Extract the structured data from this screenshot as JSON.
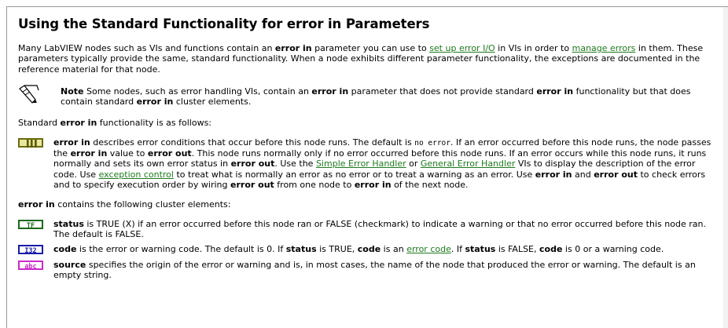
{
  "title": "Using the Standard Functionality for error in Parameters",
  "intro": {
    "t1": "Many LabVIEW nodes such as VIs and functions contain an ",
    "b1": "error in",
    "t2": " parameter you can use to ",
    "link1": "set up error I/O",
    "t3": " in VIs in order to ",
    "link2": "manage errors",
    "t4": " in them. These parameters typically provide the same, standard functionality. When a node exhibits different parameter functionality, the exceptions are documented in the reference material for that node."
  },
  "note": {
    "label": "Note",
    "t1": "  Some nodes, such as error handling VIs, contain an ",
    "b1": "error in",
    "t2": " parameter that does not provide standard ",
    "b2": "error in",
    "t3": " functionality but that does contain standard ",
    "b3": "error in",
    "t4": " cluster elements."
  },
  "standard": {
    "t1": "Standard ",
    "b1": "error in",
    "t2": " functionality is as follows:"
  },
  "error_in": {
    "icon_label": "▐▐▐",
    "b1": "error in",
    "t1": " describes error conditions that occur before this node runs. The default is ",
    "mono1": "no error",
    "t2": ". If an error occurred before this node runs, the node passes the ",
    "b2": "error in",
    "t3": " value to ",
    "b3": "error out",
    "t4": ". This node runs normally only if no error occurred before this node runs. If an error occurs while this node runs, it runs normally and sets its own error status in ",
    "b4": "error out",
    "t5": ". Use the ",
    "link1": "Simple Error Handler",
    "t6": " or ",
    "link2": "General Error Handler",
    "t7": " VIs to display the description of the error code. Use ",
    "link3": "exception control",
    "t8": " to treat what is normally an error as no error or to treat a warning as an error. Use ",
    "b5": "error in",
    "t9": " and ",
    "b6": "error out",
    "t10": " to check errors and to specify execution order by wiring ",
    "b7": "error out",
    "t11": " from one node to ",
    "b8": "error in",
    "t12": " of the next node."
  },
  "contains": {
    "b1": "error in",
    "t1": " contains the following cluster elements:"
  },
  "status": {
    "icon_label": "TF",
    "b1": "status",
    "t1": " is TRUE (X) if an error occurred before this node ran or FALSE (checkmark) to indicate a warning or that no error occurred before this node ran. The default is FALSE."
  },
  "code": {
    "icon_label": "I32",
    "b1": "code",
    "t1": " is the error or warning code. The default is 0. If ",
    "b2": "status",
    "t2": " is TRUE, ",
    "b3": "code",
    "t3": " is an ",
    "link1": "error code",
    "t4": ". If ",
    "b4": "status",
    "t5": " is FALSE, ",
    "b5": "code",
    "t6": " is 0 or a warning code."
  },
  "source": {
    "icon_label": "abc",
    "b1": "source",
    "t1": " specifies the origin of the error or warning and is, in most cases, the name of the node that produced the error or warning. The default is an empty string."
  },
  "colors": {
    "link": "#1e7a1e",
    "bool": "#1a6a1a",
    "i32": "#1a1aaa",
    "string": "#cc2acc",
    "cluster": "#6a6a10"
  }
}
